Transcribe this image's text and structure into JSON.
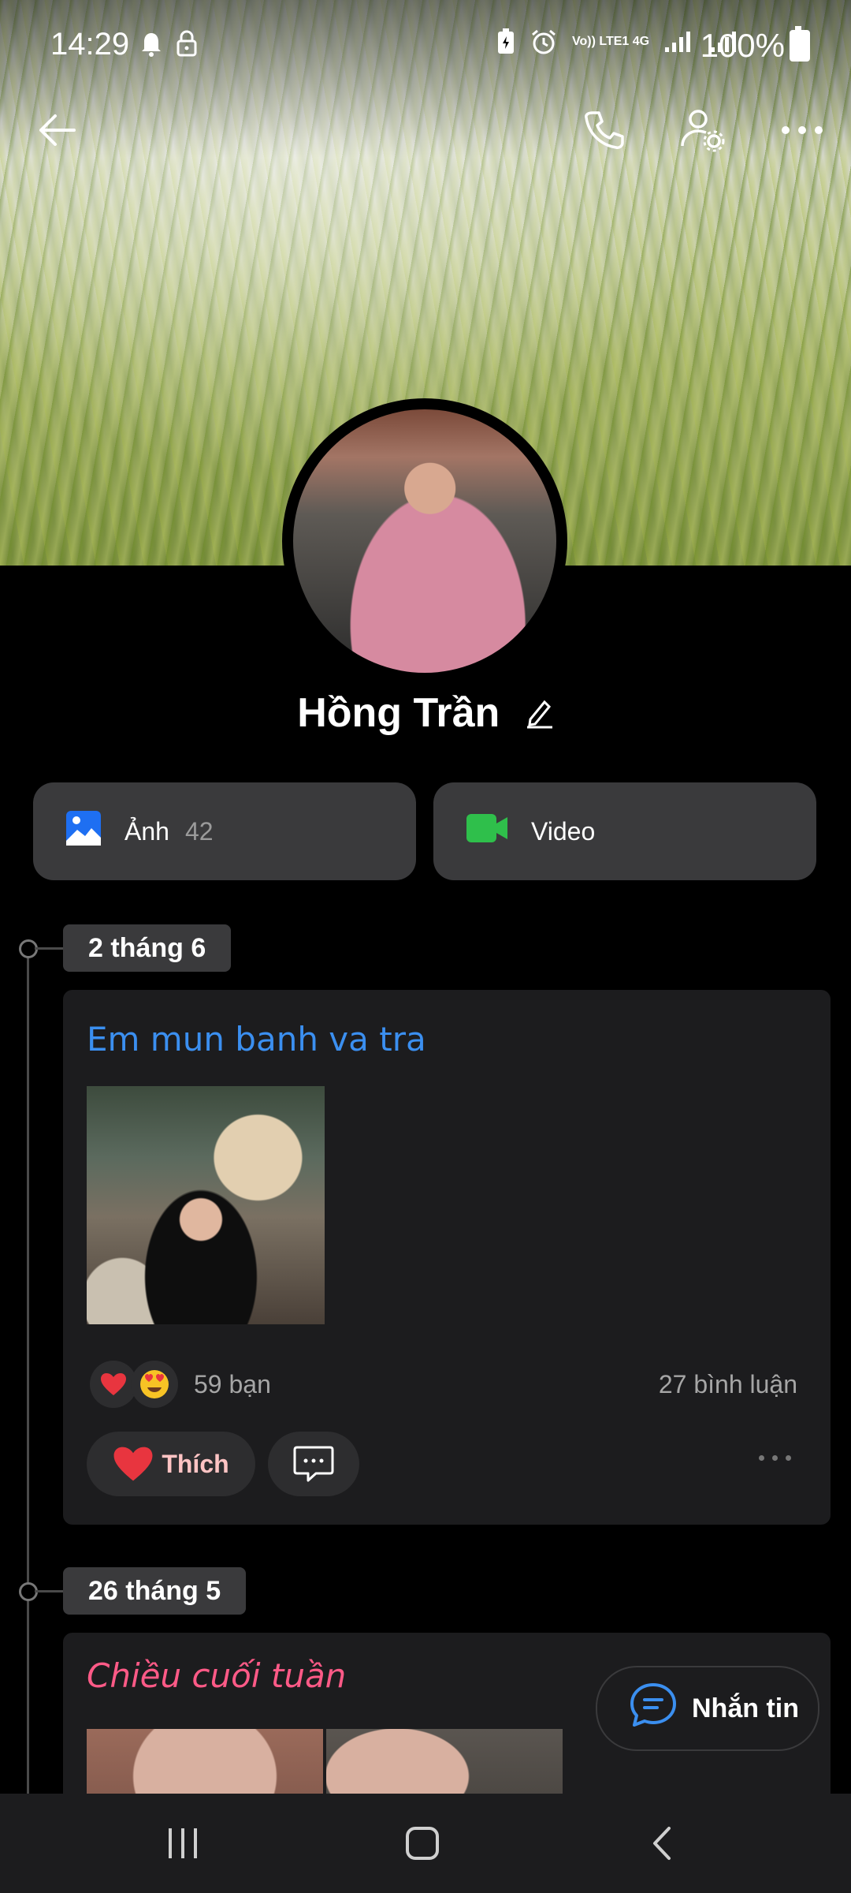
{
  "status_bar": {
    "time": "14:29",
    "battery": "100%",
    "network_label": "Vo)) LTE1 4G"
  },
  "profile": {
    "name": "Hồng Trần"
  },
  "media": {
    "photos_label": "Ảnh",
    "photos_count": "42",
    "video_label": "Video"
  },
  "posts": [
    {
      "date": "2 tháng 6",
      "title": "Em mun banh va tra",
      "reactions_count": "59 bạn",
      "comments_count": "27 bình luận",
      "like_label": "Thích"
    },
    {
      "date": "26 tháng 5",
      "title": "Chiều cuối tuần"
    }
  ],
  "floating": {
    "message_label": "Nhắn tin"
  },
  "colors": {
    "accent_blue": "#3b8ff0",
    "accent_pink": "#ff5a87",
    "photo_icon": "#1e6ff2",
    "video_icon": "#2fbf4b"
  }
}
